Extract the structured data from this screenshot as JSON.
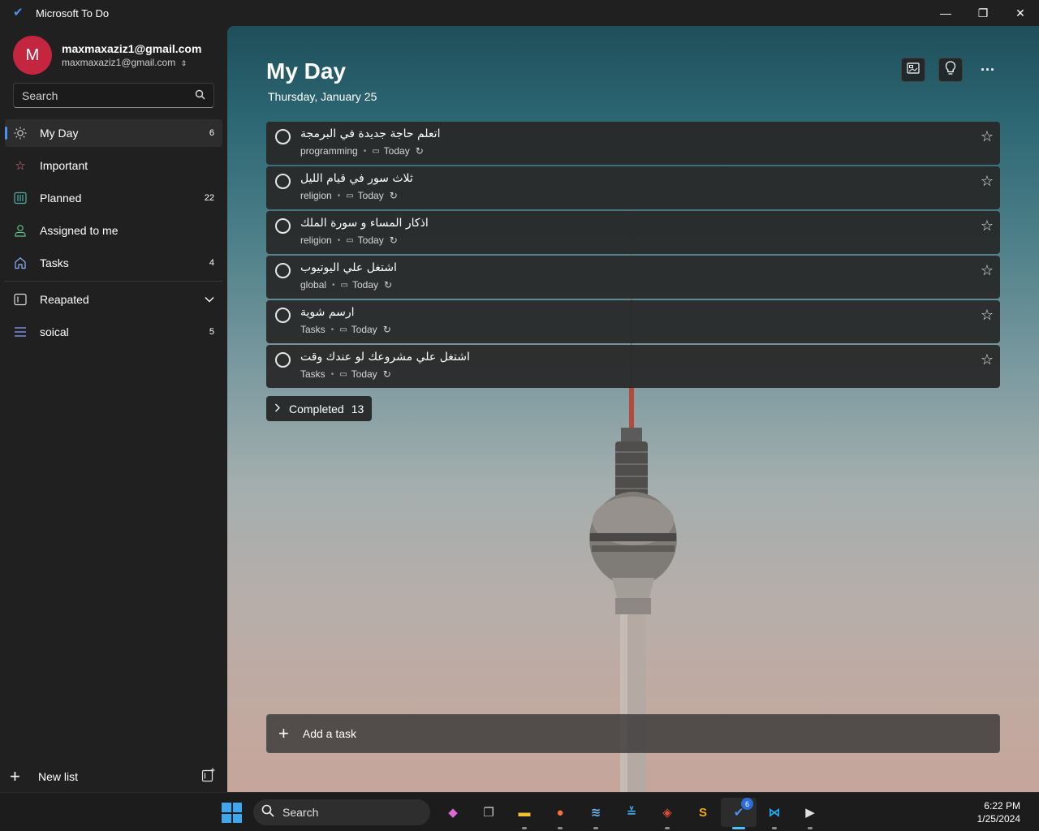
{
  "window": {
    "title": "Microsoft To Do"
  },
  "account": {
    "initial": "M",
    "name": "maxmaxaziz1@gmail.com",
    "email": "maxmaxaziz1@gmail.com"
  },
  "search": {
    "placeholder": "Search"
  },
  "nav": [
    {
      "label": "My Day",
      "count": "6",
      "icon": "sun-icon",
      "color": "#cfcfcf"
    },
    {
      "label": "Important",
      "count": "",
      "icon": "star-icon",
      "color": "#e8758f"
    },
    {
      "label": "Planned",
      "count": "22",
      "icon": "calendar-grid-icon",
      "color": "#4fb1a6"
    },
    {
      "label": "Assigned to me",
      "count": "",
      "icon": "person-icon",
      "color": "#5fc08a"
    },
    {
      "label": "Tasks",
      "count": "4",
      "icon": "home-icon",
      "color": "#8ab4f8"
    }
  ],
  "lists": [
    {
      "label": "Reapated",
      "type": "group",
      "icon": "group-icon"
    },
    {
      "label": "soical",
      "count": "5",
      "icon": "list-lines-icon",
      "color": "#8a9cf7"
    }
  ],
  "sidebar_footer": {
    "new_list": "New list"
  },
  "main": {
    "title": "My Day",
    "date": "Thursday, January 25",
    "tasks": [
      {
        "title": "اتعلم حاجة جديدة في البرمجة",
        "list": "programming",
        "due": "Today"
      },
      {
        "title": "ثلاث سور في قيام الليل",
        "list": "religion",
        "due": "Today"
      },
      {
        "title": "اذكار المساء و سورة الملك",
        "list": "religion",
        "due": "Today"
      },
      {
        "title": "اشتغل علي اليوتيوب",
        "list": "global",
        "due": "Today"
      },
      {
        "title": "ارسم شوية",
        "list": "Tasks",
        "due": "Today"
      },
      {
        "title": "اشتغل علي مشروعك لو عندك وقت",
        "list": "Tasks",
        "due": "Today"
      }
    ],
    "completed": {
      "label": "Completed",
      "count": "13"
    },
    "add_task": {
      "placeholder": "Add a task"
    }
  },
  "taskbar": {
    "search_label": "Search",
    "apps": [
      {
        "name": "copilot",
        "glyph": "◆",
        "color": "#d86bd4"
      },
      {
        "name": "task-view",
        "glyph": "❐",
        "color": "#c8c8c8"
      },
      {
        "name": "file-explorer",
        "glyph": "▬",
        "color": "#f1c232"
      },
      {
        "name": "firefox",
        "glyph": "●",
        "color": "#ff7139"
      },
      {
        "name": "resource-monitor",
        "glyph": "≋",
        "color": "#69b4e8"
      },
      {
        "name": "cursor-app",
        "glyph": "≚",
        "color": "#3ea6e0"
      },
      {
        "name": "git",
        "glyph": "◈",
        "color": "#e04e39"
      },
      {
        "name": "sublime-text",
        "glyph": "S",
        "color": "#f5a623"
      },
      {
        "name": "microsoft-todo",
        "glyph": "✔",
        "color": "#4f8ff7",
        "badge": "6"
      },
      {
        "name": "vscode",
        "glyph": "⋈",
        "color": "#23a9f2"
      },
      {
        "name": "media-player",
        "glyph": "▶",
        "color": "#e0e0e0"
      }
    ],
    "time": "6:22 PM",
    "date": "1/25/2024"
  }
}
